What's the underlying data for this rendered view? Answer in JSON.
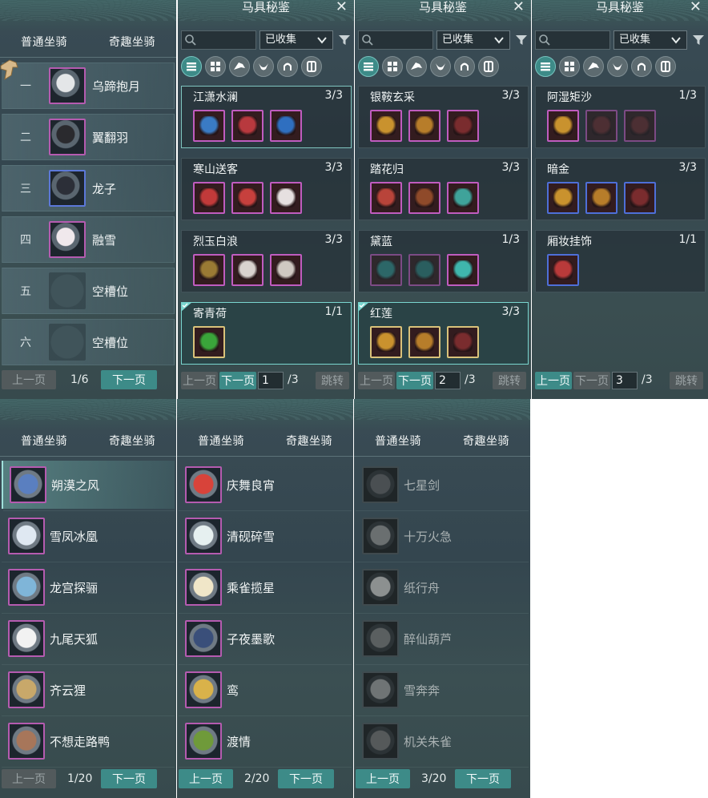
{
  "mount_list": {
    "tabs": [
      "普通坐骑",
      "奇趣坐骑"
    ],
    "slots": [
      {
        "num": "一",
        "name": "乌蹄抱月",
        "color": "#e4e6e8",
        "frame": "pink",
        "empty": false
      },
      {
        "num": "二",
        "name": "翼翻羽",
        "color": "#2a2a2e",
        "frame": "pink",
        "empty": false
      },
      {
        "num": "三",
        "name": "龙子",
        "color": "#2c2f38",
        "frame": "blue",
        "empty": false
      },
      {
        "num": "四",
        "name": "融雪",
        "color": "#f0e8ec",
        "frame": "pink",
        "empty": false
      },
      {
        "num": "五",
        "name": "空槽位",
        "color": "#3e5157",
        "frame": "none",
        "empty": true
      },
      {
        "num": "六",
        "name": "空槽位",
        "color": "#3e5157",
        "frame": "none",
        "empty": true
      }
    ],
    "pager": {
      "prev": "上一页",
      "page": "1/6",
      "next": "下一页"
    }
  },
  "catalogs": [
    {
      "title": "马具秘鉴",
      "filter": "已收集",
      "sets": [
        {
          "name": "江潇水澜",
          "count": "3/3",
          "state": "sel",
          "items": [
            {
              "frame": "pink",
              "color": "#3a7bc4"
            },
            {
              "frame": "pink",
              "color": "#b8393e"
            },
            {
              "frame": "pink",
              "color": "#2f6fc0"
            }
          ]
        },
        {
          "name": "寒山送客",
          "count": "3/3",
          "state": "",
          "items": [
            {
              "frame": "pink",
              "color": "#c23a3a"
            },
            {
              "frame": "pink",
              "color": "#c7403d"
            },
            {
              "frame": "pink",
              "color": "#e6e0e0"
            }
          ]
        },
        {
          "name": "烈玉白浪",
          "count": "3/3",
          "state": "",
          "items": [
            {
              "frame": "pink",
              "color": "#9a7a34"
            },
            {
              "frame": "pink",
              "color": "#d9d3cf"
            },
            {
              "frame": "pink",
              "color": "#cfc9c2"
            }
          ]
        },
        {
          "name": "寄青荷",
          "count": "1/1",
          "state": "done",
          "items": [
            {
              "frame": "gold",
              "color": "#3aa53a"
            }
          ]
        }
      ],
      "pager": {
        "prev": "上一页",
        "next": "下一页",
        "page": "1",
        "total": "/3",
        "jump": "跳转"
      }
    },
    {
      "title": "马具秘鉴",
      "filter": "已收集",
      "sets": [
        {
          "name": "银鞍玄采",
          "count": "3/3",
          "state": "",
          "items": [
            {
              "frame": "pink",
              "color": "#c9922e"
            },
            {
              "frame": "pink",
              "color": "#b77d2a"
            },
            {
              "frame": "pink",
              "color": "#7a2c2e"
            }
          ]
        },
        {
          "name": "踏花归",
          "count": "3/3",
          "state": "",
          "items": [
            {
              "frame": "pink",
              "color": "#b9443a"
            },
            {
              "frame": "pink",
              "color": "#8f4a2a"
            },
            {
              "frame": "pink",
              "color": "#3fa39a"
            }
          ]
        },
        {
          "name": "黛蓝",
          "count": "1/3",
          "state": "",
          "items": [
            {
              "frame": "pink",
              "color": "#2f8f8c",
              "dim": true
            },
            {
              "frame": "pink",
              "color": "#2a7e7a",
              "dim": true
            },
            {
              "frame": "pink",
              "color": "#3fb6ad"
            }
          ]
        },
        {
          "name": "红莲",
          "count": "3/3",
          "state": "done",
          "items": [
            {
              "frame": "gold",
              "color": "#c9922e"
            },
            {
              "frame": "gold",
              "color": "#b77d2a"
            },
            {
              "frame": "gold",
              "color": "#7a2c2e"
            }
          ]
        }
      ],
      "pager": {
        "prev": "上一页",
        "next": "下一页",
        "page": "2",
        "total": "/3",
        "jump": "跳转"
      }
    },
    {
      "title": "马具秘鉴",
      "filter": "已收集",
      "sets": [
        {
          "name": "阿湿矩沙",
          "count": "1/3",
          "state": "",
          "items": [
            {
              "frame": "pink",
              "color": "#c9922e"
            },
            {
              "frame": "pink",
              "color": "#6b2a2c",
              "dim": true
            },
            {
              "frame": "pink",
              "color": "#6a2a2c",
              "dim": true
            }
          ]
        },
        {
          "name": "暗金",
          "count": "3/3",
          "state": "",
          "items": [
            {
              "frame": "blue",
              "color": "#c9922e"
            },
            {
              "frame": "blue",
              "color": "#b77d2a"
            },
            {
              "frame": "blue",
              "color": "#7a2c2e"
            }
          ]
        },
        {
          "name": "厢妆挂饰",
          "count": "1/1",
          "state": "",
          "items": [
            {
              "frame": "blue",
              "color": "#b93a3a"
            }
          ]
        }
      ],
      "pager": {
        "prev": "上一页",
        "next": "下一页",
        "page": "3",
        "total": "/3",
        "jump": "跳转"
      }
    }
  ],
  "fun_lists": [
    {
      "tabs": [
        "普通坐骑",
        "奇趣坐骑"
      ],
      "items": [
        {
          "name": "朔漠之风",
          "color": "#5a7fc0",
          "selected": true
        },
        {
          "name": "雪凤冰凰",
          "color": "#dfe8f2",
          "selected": false
        },
        {
          "name": "龙宫探骊",
          "color": "#7fb5d8",
          "selected": false
        },
        {
          "name": "九尾天狐",
          "color": "#f2f2f2",
          "selected": false
        },
        {
          "name": "齐云狸",
          "color": "#c8a86a",
          "selected": false
        },
        {
          "name": "不想走路鸭",
          "color": "#a7765a",
          "selected": false
        }
      ],
      "pager": {
        "prev": "上一页",
        "page": "1/20",
        "next": "下一页",
        "prev_enabled": false
      }
    },
    {
      "tabs": [
        "普通坐骑",
        "奇趣坐骑"
      ],
      "items": [
        {
          "name": "庆舞良宵",
          "color": "#d8433a",
          "selected": false
        },
        {
          "name": "清砚碎雪",
          "color": "#e6f0f0",
          "selected": false
        },
        {
          "name": "乘雀揽星",
          "color": "#f0e6c8",
          "selected": false
        },
        {
          "name": "子夜墨歌",
          "color": "#3a4f7a",
          "selected": false
        },
        {
          "name": "鸾",
          "color": "#d9b24a",
          "selected": false
        },
        {
          "name": "渡情",
          "color": "#6f9a3a",
          "selected": false
        }
      ],
      "pager": {
        "prev": "上一页",
        "page": "2/20",
        "next": "下一页",
        "prev_enabled": true
      }
    },
    {
      "tabs": [
        "普通坐骑",
        "奇趣坐骑"
      ],
      "items": [
        {
          "name": "七星剑",
          "color": "#4a4f52",
          "selected": false
        },
        {
          "name": "十万火急",
          "color": "#6a6f70",
          "selected": false
        },
        {
          "name": "纸行舟",
          "color": "#8c9090",
          "selected": false
        },
        {
          "name": "醉仙葫芦",
          "color": "#5a5f60",
          "selected": false
        },
        {
          "name": "雪奔奔",
          "color": "#6f7475",
          "selected": false
        },
        {
          "name": "机关朱雀",
          "color": "#55595a",
          "selected": false
        }
      ],
      "pager": {
        "prev": "上一页",
        "page": "3/20",
        "next": "下一页",
        "prev_enabled": true
      }
    }
  ]
}
